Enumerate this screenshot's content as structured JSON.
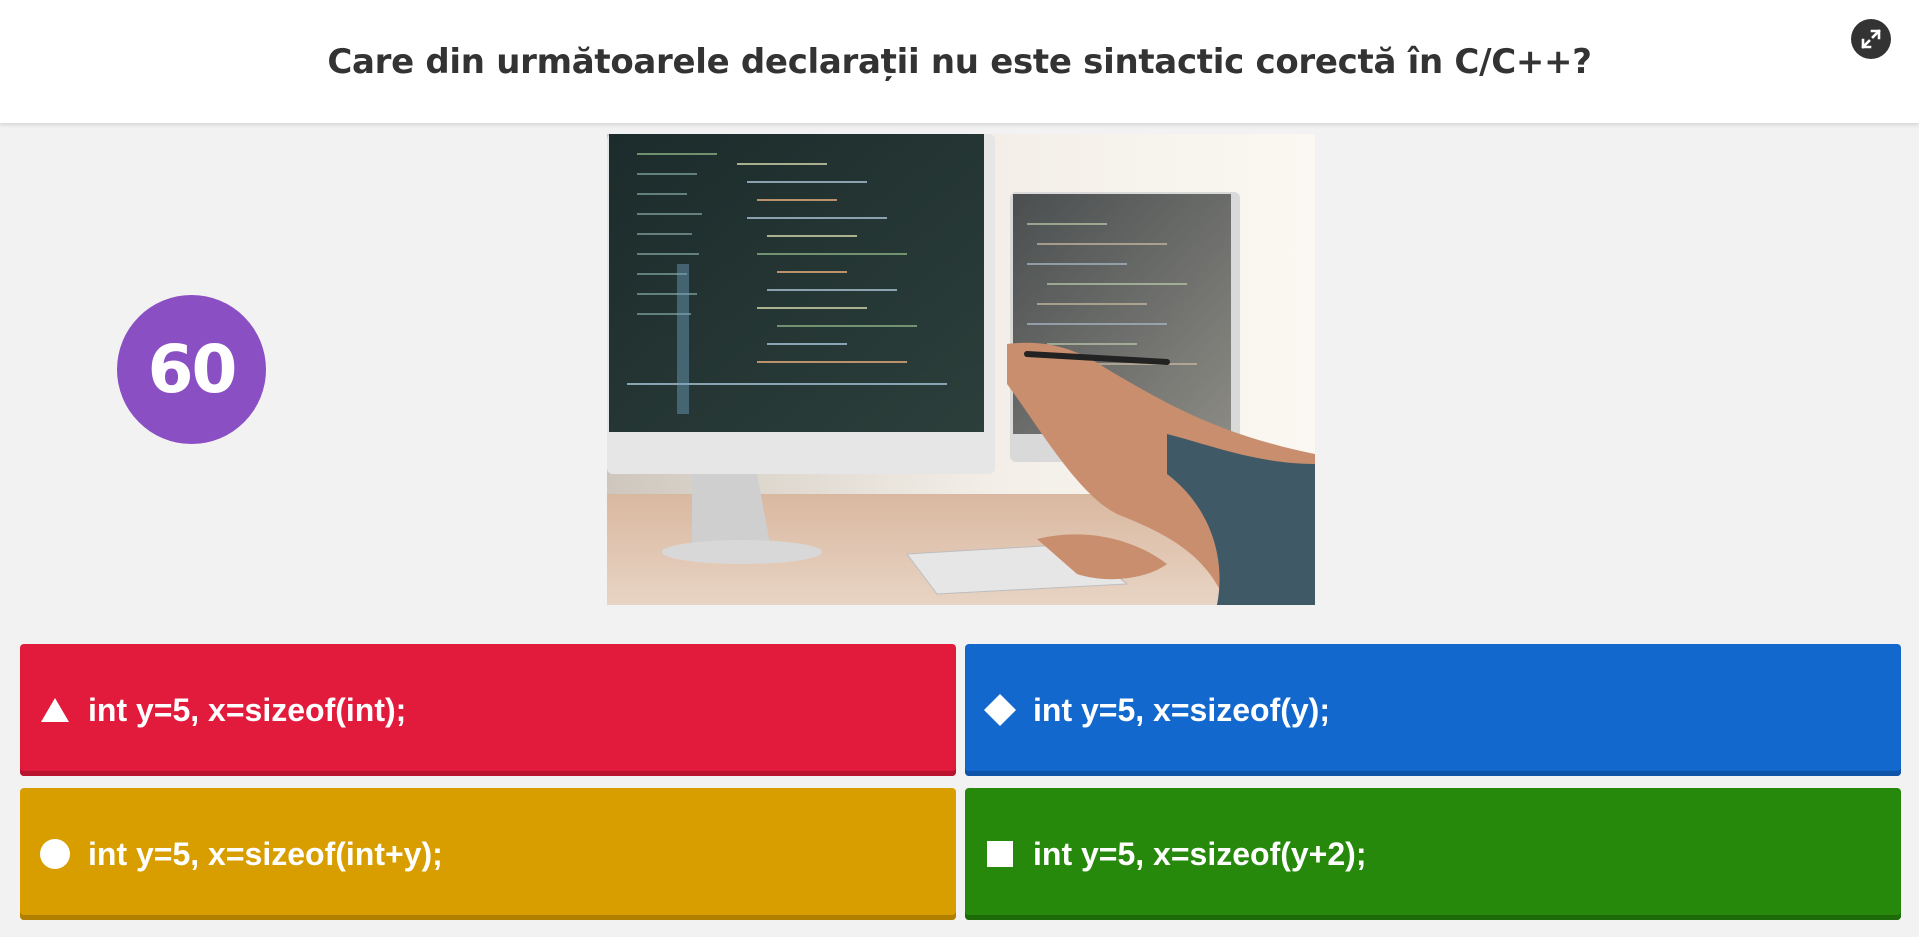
{
  "question": {
    "text": "Care din următoarele declarații nu este sintactic corectă în C/C++?"
  },
  "timer": {
    "value": "60",
    "color": "#8b4fc4"
  },
  "image": {
    "description_icon": "code-monitors-photo-icon"
  },
  "fullscreen": {
    "icon": "expand-icon"
  },
  "answers": [
    {
      "shape": "triangle",
      "label": "int y=5, x=sizeof(int);",
      "color": "#e21b3c",
      "shadow": "#b8142f"
    },
    {
      "shape": "diamond",
      "label": "int y=5, x=sizeof(y);",
      "color": "#1368ce",
      "shadow": "#0f54a8"
    },
    {
      "shape": "circle",
      "label": "int y=5, x=sizeof(int+y);",
      "color": "#d89e00",
      "shadow": "#b07f00"
    },
    {
      "shape": "square",
      "label": "int y=5, x=sizeof(y+2);",
      "color": "#26890c",
      "shadow": "#1d6a09"
    }
  ]
}
